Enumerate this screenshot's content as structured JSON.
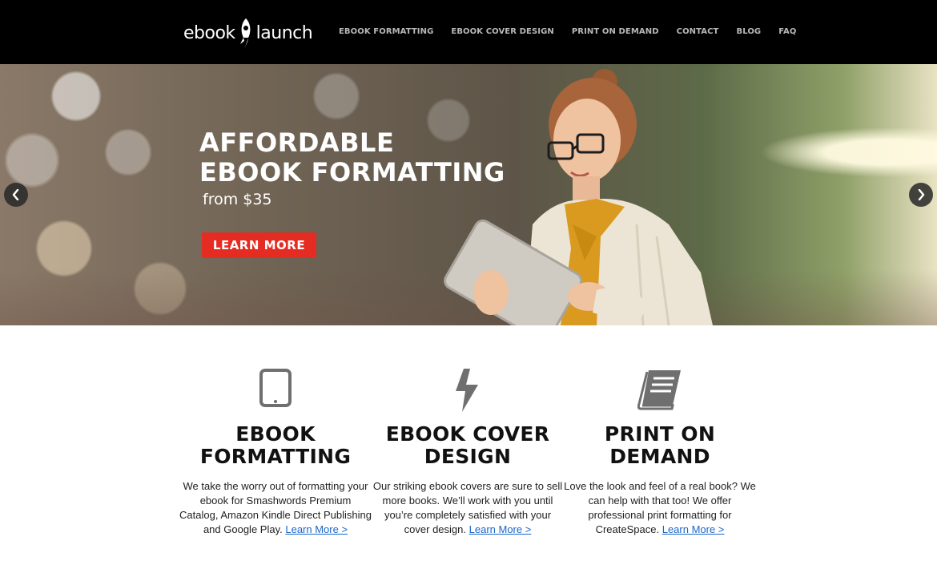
{
  "brand": {
    "logo_left": "ebook",
    "logo_right": "launch"
  },
  "nav": {
    "items": [
      "EBOOK FORMATTING",
      "EBOOK COVER DESIGN",
      "PRINT ON DEMAND",
      "CONTACT",
      "BLOG",
      "FAQ"
    ]
  },
  "hero": {
    "title_line1": "AFFORDABLE",
    "title_line2": "EBOOK FORMATTING",
    "subtitle": "from $35",
    "cta": "LEARN MORE",
    "prev_icon": "chevron-left-icon",
    "next_icon": "chevron-right-icon"
  },
  "features": [
    {
      "icon": "tablet-icon",
      "title_line1": "EBOOK",
      "title_line2": "FORMATTING",
      "text": "We take the worry out of formatting your ebook for Smashwords Premium Catalog, Amazon Kindle Direct Publishing and Google Play.",
      "link": "Learn More >"
    },
    {
      "icon": "lightning-bolt-icon",
      "title_line1": "EBOOK COVER",
      "title_line2": "DESIGN",
      "text": "Our striking ebook covers are sure to sell more books. We’ll work with you until you’re completely satisfied with your cover design.",
      "link": "Learn More >"
    },
    {
      "icon": "book-icon",
      "title_line1": "PRINT ON",
      "title_line2": "DEMAND",
      "text": "Love the look and feel of a real book? We can help with that too! We offer professional print formatting for CreateSpace.",
      "link": "Learn More >"
    }
  ],
  "colors": {
    "header_bg": "#000000",
    "cta_red": "#e42c22",
    "link_blue": "#1a66c9",
    "icon_gray": "#6f6f6f"
  }
}
